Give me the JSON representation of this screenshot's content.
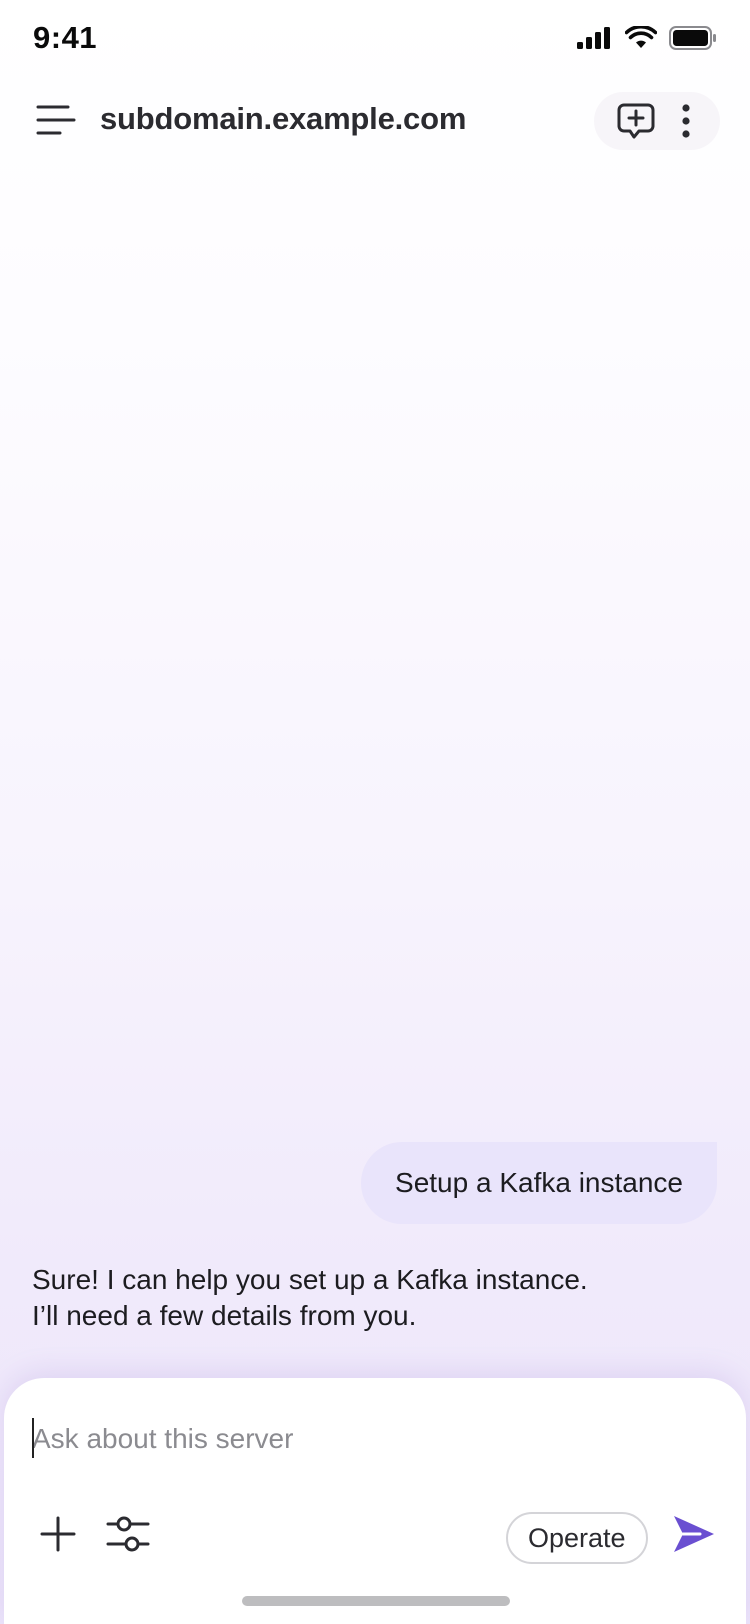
{
  "status_bar": {
    "time": "9:41"
  },
  "header": {
    "title": "subdomain.example.com",
    "menu_icon": "hamburger-menu-icon",
    "new_chat_icon": "new-chat-plus-icon",
    "more_icon": "more-vertical-icon"
  },
  "chat": {
    "messages": [
      {
        "role": "user",
        "text": "Setup a Kafka instance"
      },
      {
        "role": "assistant",
        "lines": [
          "Sure! I can help you set up a Kafka instance.",
          "I’ll need a few details from you."
        ]
      }
    ]
  },
  "composer": {
    "placeholder": "Ask about this server",
    "value": "",
    "attach_icon": "plus-icon",
    "tools_icon": "sliders-icon",
    "mode_label": "Operate",
    "send_icon": "send-icon"
  },
  "colors": {
    "accent": "#6a4fd1",
    "user_bubble": "#e9e4fb",
    "background_bottom": "#ece4fa"
  }
}
